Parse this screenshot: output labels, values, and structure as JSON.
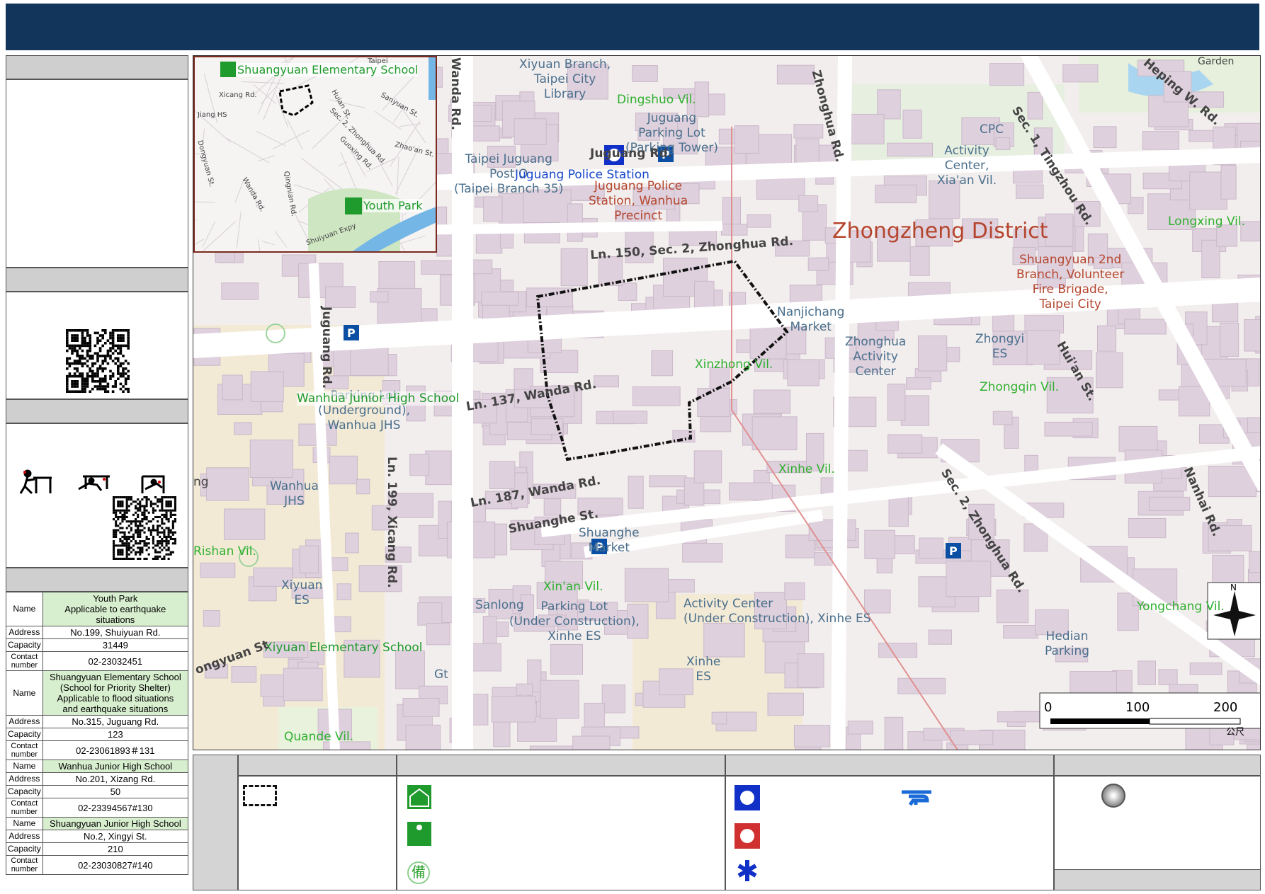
{
  "map": {
    "district": "Zhongzheng District",
    "villages": [
      "Dingshuo Vil.",
      "Longxing Vil.",
      "Xinzhong Vil.",
      "Zhongqin Vil.",
      "Xinhe Vil.",
      "Xin'an Vil.",
      "Yongchang Vil.",
      "Rishan Vil.",
      "Quande Vil."
    ],
    "roads": {
      "juguang": "Juguang Rd.",
      "ln150": "Ln. 150, Sec. 2, Zhonghua Rd.",
      "ln137": "Ln. 137, Wanda Rd.",
      "ln187": "Ln. 187, Wanda Rd.",
      "shuanghe": "Shuanghe St.",
      "wanda": "Wanda Rd.",
      "juguang_v": "Juguang Rd.",
      "xicang": "Ln. 199, Xicang Rd.",
      "zhonghua_top": "Zhonghua Rd.",
      "sec1tingzhou": "Sec. 1, Tingzhou Rd.",
      "sec2zhonghua": "Sec. 2, Zhonghua Rd.",
      "huian": "Hui'an St.",
      "nanhai": "Nanhai Rd.",
      "heping": "Heping W. Rd.",
      "garden": "Garden",
      "ng": "ng",
      "ongyuan": "ongyuan St"
    },
    "pois": {
      "library": "Xiyuan Branch,\nTaipei City\nLibrary",
      "parking_tower": "Juguang\nParking Lot\n(Parking Tower)",
      "post": "Taipei Juguang\nPost O\n(Taipei Branch 35)",
      "police_station": "Juguang Police Station",
      "police_precinct": "Juguang Police\nStation, Wanhua\nPrecinct",
      "cpc": "CPC",
      "activity_xiaan": "Activity\nCenter,\nXia'an Vil.",
      "fire_brigade": "Shuangyuan 2nd\nBranch, Volunteer\nFire Brigade,\nTaipei City",
      "nanjichang": "Nanjichang\nMarket",
      "zhonghua_activity": "Zhonghua\nActivity\nCenter",
      "zhongyi": "Zhongyi\nES",
      "parking_underground": "Parking Lot\n(Underground),\nWanhua JHS",
      "wanhua_jhs_shelter": "Wanhua Junior High School",
      "wanhua_jhs": "Wanhua\nJHS",
      "shuanghe_market": "Shuanghe\nMarket",
      "sanlong": "Sanlong",
      "parking_construction": "Parking Lot\n(Under Construction),\nXinhe ES",
      "activity_construction": "Activity Center\n(Under Construction), Xinhe ES",
      "xiyuan_es": "Xiyuan\nES",
      "xiyuan_shelter": "Xiyuan Elementary School",
      "gt": "Gt",
      "xinhe_es": "Xinhe\nES",
      "hedian": "Hedian\nParking"
    },
    "scale": {
      "ticks": [
        "0",
        "100",
        "200"
      ],
      "unit": "公尺"
    },
    "north": "N"
  },
  "inset": {
    "shuangyuan": "Shuangyuan Elementary School",
    "youth_park": "Youth Park",
    "roads": [
      "Xicang Rd.",
      "Huian St.",
      "Sanyuan St.",
      "Sec. 2, Zhonghua Rd.",
      "Guoxing Rd.",
      "Zhao'an St.",
      "Dongyuan St.",
      "Qingnian Rd.",
      "Wanda Rd.",
      "Shuiyuan Expy",
      "Jiang HS",
      "Taipei"
    ]
  },
  "shelters": [
    {
      "name": "Youth Park\nApplicable to earthquake situations",
      "address": "No.199, Shuiyuan Rd.",
      "capacity": "31449",
      "contact": "02-23032451"
    },
    {
      "name": "Shuangyuan Elementary School\n(School for Priority Shelter)\nApplicable to flood situations\nand earthquake situations",
      "address": "No.315, Juguang Rd.",
      "capacity": "123",
      "contact": "02-23061893＃131"
    },
    {
      "name": "Wanhua Junior High School",
      "address": "No.201, Xizang Rd.",
      "capacity": "50",
      "contact": "02-23394567#130"
    },
    {
      "name": "Shuangyuan Junior High School",
      "address": "No.2, Xingyi St.",
      "capacity": "210",
      "contact": "02-23030827#140"
    }
  ],
  "table_keys": {
    "name": "Name",
    "address": "Address",
    "capacity": "Capacity",
    "contact": "Contact\nnumber"
  },
  "icons": {
    "legend_reserve": "備",
    "colors": {
      "header": "#12355b",
      "shelter_green": "#1f9a2c",
      "police_blue": "#1030c8",
      "fire_red": "#d03030"
    }
  }
}
